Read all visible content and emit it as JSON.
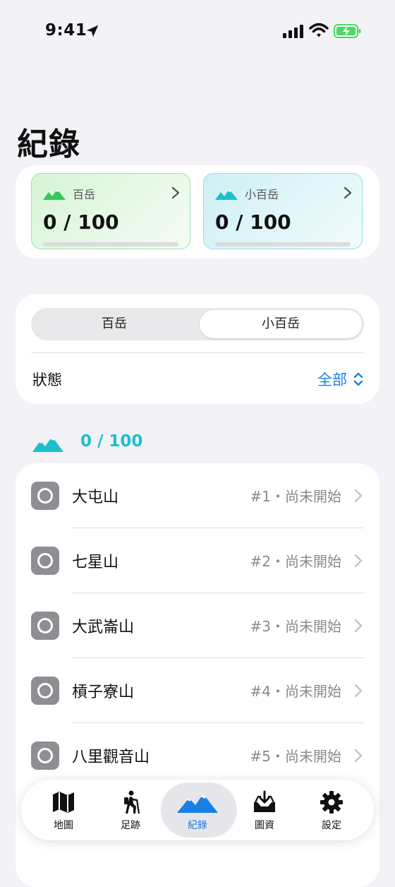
{
  "status_bar": {
    "time": "9:41"
  },
  "header": {
    "title": "紀錄"
  },
  "progress_cards": [
    {
      "label": "百岳",
      "value": "0 / 100",
      "progress": 0
    },
    {
      "label": "小百岳",
      "value": "0 / 100",
      "progress": 0
    }
  ],
  "filter": {
    "segments": [
      "百岳",
      "小百岳"
    ],
    "selected_segment": "小百岳",
    "status_label": "狀態",
    "status_value": "全部"
  },
  "summary": {
    "count": "0 / 100"
  },
  "mountains": [
    {
      "name": "大屯山",
      "meta": "#1・尚未開始"
    },
    {
      "name": "七星山",
      "meta": "#2・尚未開始"
    },
    {
      "name": "大武崙山",
      "meta": "#3・尚未開始"
    },
    {
      "name": "槓子寮山",
      "meta": "#4・尚未開始"
    },
    {
      "name": "八里觀音山",
      "meta": "#5・尚未開始"
    }
  ],
  "tabs": [
    {
      "label": "地圖",
      "icon": "map-icon"
    },
    {
      "label": "足跡",
      "icon": "hiker-icon"
    },
    {
      "label": "紀錄",
      "icon": "mountains-icon",
      "active": true
    },
    {
      "label": "圖資",
      "icon": "download-tray-icon"
    },
    {
      "label": "設定",
      "icon": "gear-icon"
    }
  ],
  "colors": {
    "accent": "#1a80e6",
    "teal": "#1cc0cc",
    "hundred_green": "#34c759"
  }
}
